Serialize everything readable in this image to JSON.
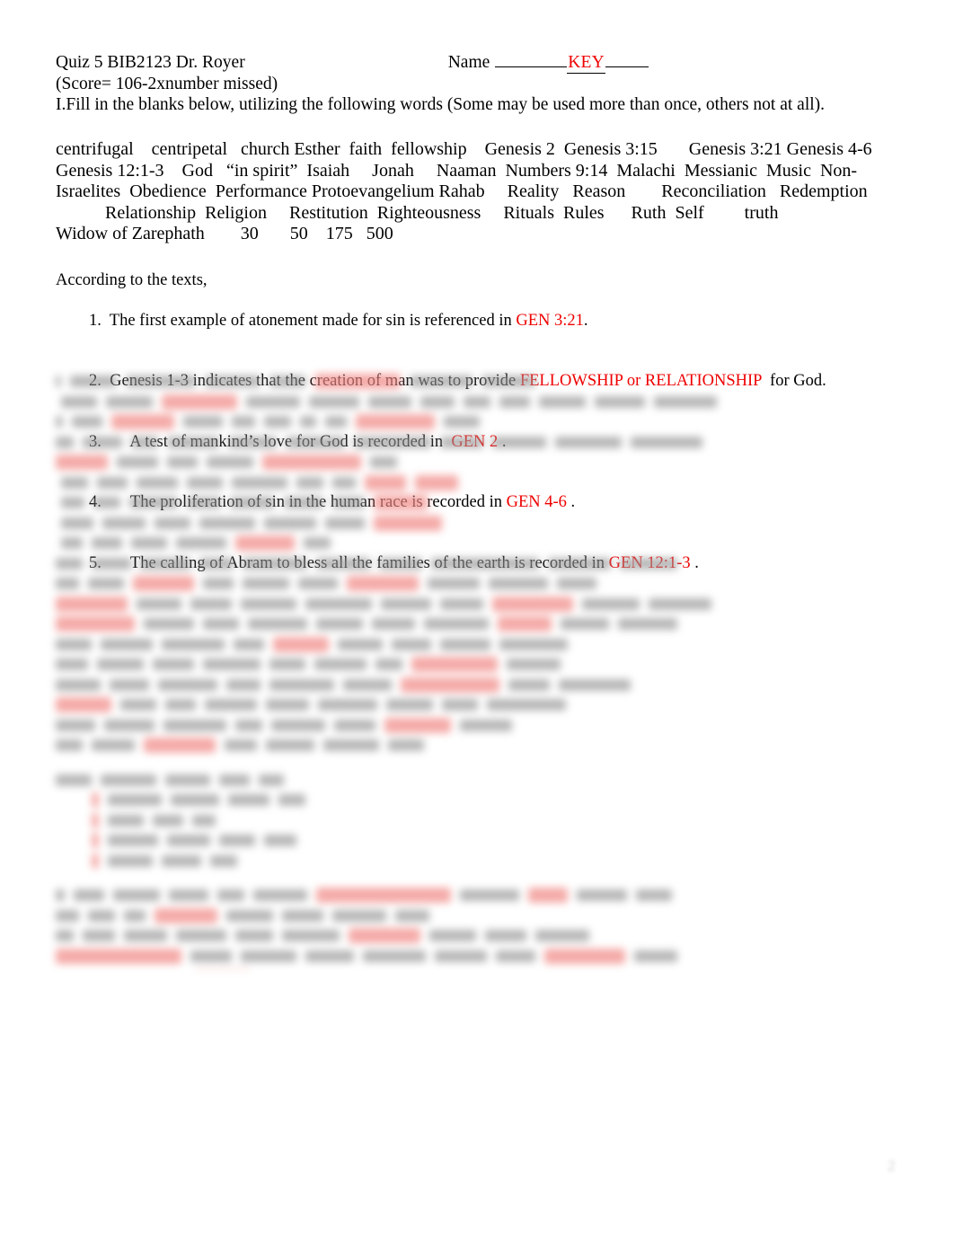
{
  "document": {
    "header": {
      "title": "Quiz 5 BIB2123 Dr. Royer",
      "name_label": "Name",
      "name_value": "KEY",
      "score_line": "(Score= 106-2xnumber missed)",
      "instructions": "I.Fill in the blanks below, utilizing the following words (Some may be used more than once, others not at all)."
    },
    "word_bank": {
      "lines": [
        "centrifugal    centripetal   church Esther  faith  fellowship    Genesis 2  Genesis 3:15       Genesis 3:21 Genesis 4-6",
        "Genesis 12:1-3    God   “in spirit”  Isaiah     Jonah     Naaman  Numbers 9:14  Malachi  Messianic  Music  Non-",
        "Israelites  Obedience  Performance Protoevangelium Rahab     Reality   Reason        Reconciliation   Redemption",
        "           Relationship  Religion     Restitution  Righteousness     Rituals  Rules      Ruth  Self         truth",
        "Widow of Zarephath        30       50    175   500"
      ],
      "terms": [
        "centrifugal",
        "centripetal",
        "church",
        "Esther",
        "faith",
        "fellowship",
        "Genesis 2",
        "Genesis 3:15",
        "Genesis 3:21",
        "Genesis 4-6",
        "Genesis 12:1-3",
        "God",
        "“in spirit”",
        "Isaiah",
        "Jonah",
        "Naaman",
        "Numbers 9:14",
        "Malachi",
        "Messianic",
        "Music",
        "Non-Israelites",
        "Obedience",
        "Performance",
        "Protoevangelium",
        "Rahab",
        "Reality",
        "Reason",
        "Reconciliation",
        "Redemption",
        "Relationship",
        "Religion",
        "Restitution",
        "Righteousness",
        "Rituals",
        "Rules",
        "Ruth",
        "Self",
        "truth",
        "Widow of Zarephath",
        "30",
        "50",
        "175",
        "500"
      ]
    },
    "questions": {
      "intro": "According to the texts,",
      "items": [
        {
          "number": "1.",
          "gap": "  ",
          "text_before": "The first example of atonement made for sin is referenced in ",
          "answer": "GEN 3:21",
          "text_after": ".",
          "highlighted": false
        },
        {
          "number": "2.",
          "gap": "  ",
          "text_before": "Genesis 1-3 indicates that the creation of man was to provide ",
          "answer": "FELLOWSHIP or RELATIONSHIP",
          "text_after": "  for God.",
          "highlighted": true
        },
        {
          "number": "3.",
          "gap": "       ",
          "text_before": "A test of mankind’s love for God is recorded in  ",
          "answer": "GEN 2",
          "text_after": " .",
          "highlighted": false
        },
        {
          "number": "4.",
          "gap": "       ",
          "text_before": "The proliferation of sin in the human race is recorded in ",
          "answer": "GEN 4-6",
          "text_after": " .",
          "highlighted": false
        },
        {
          "number": "5.",
          "gap": "       ",
          "text_before": "The calling of Abram to bless all the families of the earth is recorded in ",
          "answer": "GEN 12:1-3",
          "text_after": " .",
          "highlighted": false
        }
      ]
    },
    "redacted_body": {
      "description": "blurred unreadable remainder of quiz with red highlighted answers",
      "page_number": "2"
    },
    "colors": {
      "answer_red": "#ee0000",
      "highlight_pink": "#f08a86",
      "text_black": "#000000",
      "paper": "#ffffff"
    }
  }
}
